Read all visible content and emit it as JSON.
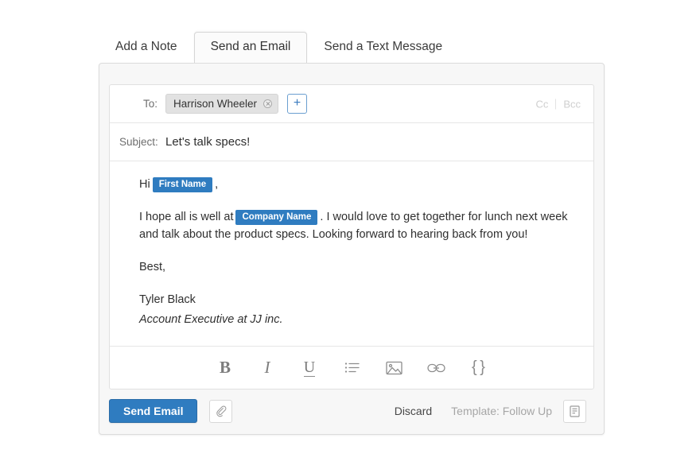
{
  "tabs": [
    {
      "label": "Add a Note",
      "active": false
    },
    {
      "label": "Send an Email",
      "active": true
    },
    {
      "label": "Send a Text Message",
      "active": false
    }
  ],
  "compose": {
    "to_label": "To:",
    "recipient": "Harrison Wheeler",
    "add_recipient_label": "+",
    "cc_label": "Cc",
    "bcc_label": "Bcc",
    "subject_label": "Subject:",
    "subject_value": "Let's talk specs!",
    "body": {
      "greeting_prefix": "Hi",
      "greeting_token": "First Name",
      "greeting_suffix": ",",
      "paragraph_prefix": "I hope all is well at",
      "paragraph_token": "Company Name",
      "paragraph_suffix": ". I would love to get together for lunch next week and talk about the product specs. Looking forward to hearing back from you!",
      "closing": "Best,",
      "signature_name": "Tyler Black",
      "signature_title": "Account Executive at JJ inc."
    }
  },
  "format_toolbar": [
    {
      "name": "bold",
      "glyph": "B"
    },
    {
      "name": "italic",
      "glyph": "I"
    },
    {
      "name": "underline",
      "glyph": "U"
    },
    {
      "name": "bulleted-list",
      "glyph": ""
    },
    {
      "name": "insert-image",
      "glyph": ""
    },
    {
      "name": "insert-link",
      "glyph": ""
    },
    {
      "name": "merge-field",
      "glyph": "{ }"
    }
  ],
  "footer": {
    "send_label": "Send Email",
    "attach_label": "",
    "discard_label": "Discard",
    "template_label": "Template: Follow Up"
  },
  "colors": {
    "accent_blue": "#2f7cc0",
    "token_blue": "#2f7cc0",
    "panel_bg": "#f7f7f7",
    "muted_text": "#a6a6a6"
  }
}
